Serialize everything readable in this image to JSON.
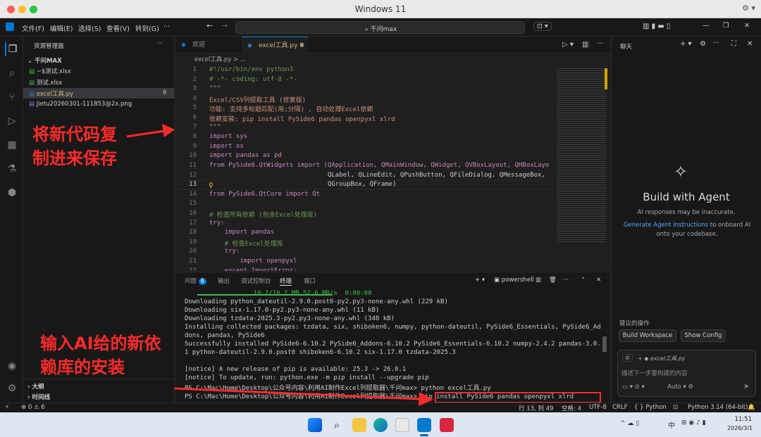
{
  "mac": {
    "title": "Windows 11"
  },
  "menubar": {
    "items": [
      "文件(F)",
      "编辑(E)",
      "选择(S)",
      "查看(V)",
      "转到(G)"
    ],
    "search_text": "千问max"
  },
  "explorer": {
    "header": "资源管理器",
    "folder": "千问MAX",
    "files": [
      {
        "name": "~$测试.xlsx",
        "badge": ""
      },
      {
        "name": "测试.xlsx",
        "badge": ""
      },
      {
        "name": "excel工具.py",
        "badge": "6"
      },
      {
        "name": "Jietu20260301-111853@2x.png",
        "badge": ""
      }
    ],
    "outline": "大纲",
    "timeline": "时间线"
  },
  "tabs": {
    "welcome": "欢迎",
    "active": "excel工具.py",
    "active_badge": "6"
  },
  "breadcrumb": "excel工具.py > ...",
  "code": {
    "line_numbers": [
      "1",
      "2",
      "3",
      "4",
      "5",
      "6",
      "7",
      "8",
      "9",
      "10",
      "11",
      "12",
      "13",
      "14",
      "15",
      "16",
      "17",
      "18",
      "19",
      "20",
      "21",
      "22"
    ],
    "lines": [
      "#!/usr/bin/env python3",
      "# -*- coding: utf-8 -*-",
      "\"\"\"",
      "Excel/CSV列提取工具 (修复版)",
      "功能: 支持多标题匹配(用;分隔) , 自动处理Excel依赖",
      "依赖安装: pip install PySide6 pandas openpyxl xlrd",
      "\"\"\"",
      "import sys",
      "import os",
      "import pandas as pd",
      "from PySide6.QtWidgets import (QApplication, QMainWindow, QWidget, QVBoxLayout, QHBoxLayo",
      "                               QLabel, QLineEdit, QPushButton, QFileDialog, QMessageBox,",
      "                               QGroupBox, QFrame)",
      "from PySide6.QtCore import Qt",
      "",
      "# 检查所有依赖 (包含Excel处理库)",
      "try:",
      "    import pandas",
      "    # 检查Excel处理库",
      "    try:",
      "        import openpyxl",
      "    except ImportError:"
    ]
  },
  "panel": {
    "tabs": [
      "问题",
      "输出",
      "调试控制台",
      "终端",
      "端口"
    ],
    "problems_badge": "6",
    "shell": "powershell"
  },
  "terminal": {
    "lines": [
      "                  10.2/10.2 MB 52.6 MB/s  0:00:00",
      "Downloading python_dateutil-2.9.0.post0-py2.py3-none-any.whl (229 kB)",
      "Downloading six-1.17.0-py2.py3-none-any.whl (11 kB)",
      "Downloading tzdata-2025.3-py2.py3-none-any.whl (348 kB)",
      "Installing collected packages: tzdata, six, shiboken6, numpy, python-dateutil, PySide6_Essentials, PySide6_Addons, pandas, PySide6",
      "Successfully installed PySide6-6.10.2 PySide6_Addons-6.10.2 PySide6_Essentials-6.10.2 numpy-2.4.2 pandas-3.0.1 python-dateutil-2.9.0.post0 shiboken6-6.10.2 six-1.17.0 tzdata-2025.3",
      "",
      "[notice] A new release of pip is available: 25.3 -> 26.0.1",
      "[notice] To update, run: python.exe -m pip install --upgrade pip",
      "PS C:\\Mac\\Home\\Desktop\\公众号内容\\利用AI制作Excel列提取器\\千问max> python excel工具.py",
      "PS C:\\Mac\\Home\\Desktop\\公众号内容\\利用AI制作Excel列提取器\\千问max> pip install PySide6 pandas openpyxl xlrd"
    ],
    "highlight_command": "pip install PySide6 pandas openpyxl xlrd"
  },
  "chat": {
    "title": "聊天",
    "heading": "Build with Agent",
    "disclaimer": "AI responses may be inaccurate.",
    "link": "Generate Agent Instructions",
    "link_rest": " to onboard AI onto your codebase.",
    "suggest_label": "建议的操作",
    "btn_build": "Build Workspace",
    "btn_config": "Show Config",
    "attachment": "excel工具.py",
    "input_placeholder": "描述下一步要构建的内容",
    "mode": "Auto"
  },
  "status": {
    "errors": "0",
    "warnings": "6",
    "position": "行 13, 列 49",
    "spaces": "空格: 4",
    "encoding": "UTF-8",
    "eol": "CRLF",
    "language": "Python",
    "interpreter": "Python 3.14 (64-bit)"
  },
  "taskbar": {
    "ime": "中",
    "time": "11:51",
    "date": "2026/3/1"
  },
  "annotations": {
    "top_line1": "将新代码复",
    "top_line2": "制进来保存",
    "bottom_line1": "输入AI给的新依",
    "bottom_line2": "赖库的安装"
  },
  "colors": {
    "annotation": "#ff2b2b",
    "accent": "#0078d4"
  }
}
